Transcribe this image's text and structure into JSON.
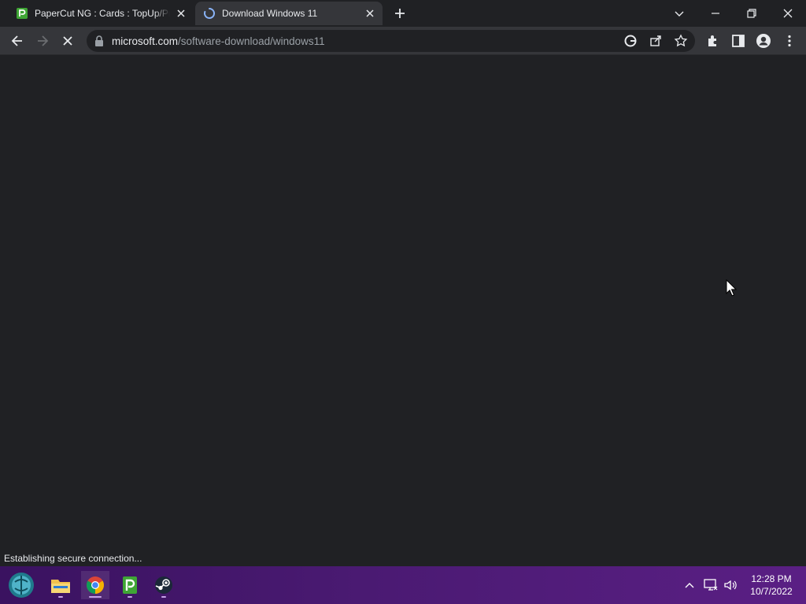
{
  "tabs": [
    {
      "title": "PaperCut NG : Cards : TopUp/Pre-paid",
      "favicon": "papercut-icon",
      "active": false
    },
    {
      "title": "Download Windows 11",
      "favicon": "loading-spinner-icon",
      "active": true
    }
  ],
  "address": {
    "host": "microsoft.com",
    "path": "/software-download/windows11"
  },
  "status": "Establishing secure connection...",
  "clock": {
    "time": "12:28 PM",
    "date": "10/7/2022"
  },
  "colors": {
    "page_bg": "#202124",
    "toolbar_bg": "#35363a",
    "spinner": "#8ab4f8",
    "papercut_green": "#3fa535",
    "taskbar": "#4a1a72"
  }
}
